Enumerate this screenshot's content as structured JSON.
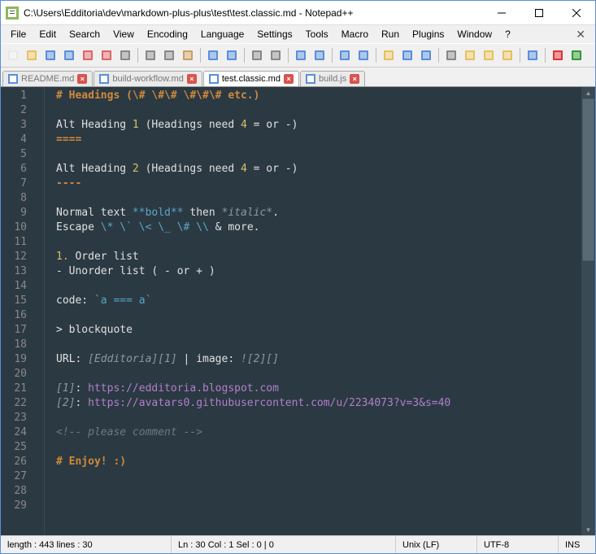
{
  "window": {
    "title": "C:\\Users\\Edditoria\\dev\\markdown-plus-plus\\test\\test.classic.md - Notepad++"
  },
  "menu": [
    "File",
    "Edit",
    "Search",
    "View",
    "Encoding",
    "Language",
    "Settings",
    "Tools",
    "Macro",
    "Run",
    "Plugins",
    "Window",
    "?"
  ],
  "tabs": [
    {
      "label": "README.md",
      "active": false
    },
    {
      "label": "build-workflow.md",
      "active": false
    },
    {
      "label": "test.classic.md",
      "active": true
    },
    {
      "label": "build.js",
      "active": false
    }
  ],
  "editor": {
    "line_count": 29,
    "lines": [
      {
        "n": 1,
        "spans": [
          {
            "t": "# Headings (\\# \\#\\# \\#\\#\\# etc.)",
            "c": "c-orange"
          }
        ]
      },
      {
        "n": 2,
        "spans": []
      },
      {
        "n": 3,
        "spans": [
          {
            "t": "Alt Heading ",
            "c": "c-white"
          },
          {
            "t": "1",
            "c": "c-yellow"
          },
          {
            "t": " (Headings need ",
            "c": "c-white"
          },
          {
            "t": "4",
            "c": "c-yellow"
          },
          {
            "t": " = or -)",
            "c": "c-white"
          }
        ]
      },
      {
        "n": 4,
        "spans": [
          {
            "t": "====",
            "c": "c-orange"
          }
        ]
      },
      {
        "n": 5,
        "spans": []
      },
      {
        "n": 6,
        "spans": [
          {
            "t": "Alt Heading ",
            "c": "c-white"
          },
          {
            "t": "2",
            "c": "c-yellow"
          },
          {
            "t": " (Headings need ",
            "c": "c-white"
          },
          {
            "t": "4",
            "c": "c-yellow"
          },
          {
            "t": " = or -)",
            "c": "c-white"
          }
        ]
      },
      {
        "n": 7,
        "spans": [
          {
            "t": "----",
            "c": "c-orange"
          }
        ]
      },
      {
        "n": 8,
        "spans": []
      },
      {
        "n": 9,
        "spans": [
          {
            "t": "Normal text ",
            "c": "c-white"
          },
          {
            "t": "**bold**",
            "c": "c-cyan"
          },
          {
            "t": " then ",
            "c": "c-white"
          },
          {
            "t": "*italic*",
            "c": "c-italic"
          },
          {
            "t": ".",
            "c": "c-white"
          }
        ]
      },
      {
        "n": 10,
        "spans": [
          {
            "t": "Escape ",
            "c": "c-white"
          },
          {
            "t": "\\* \\` \\< \\_ \\# \\\\",
            "c": "c-cyan"
          },
          {
            "t": " & more.",
            "c": "c-white"
          }
        ]
      },
      {
        "n": 11,
        "spans": []
      },
      {
        "n": 12,
        "spans": [
          {
            "t": "1.",
            "c": "c-yellow"
          },
          {
            "t": " Order list",
            "c": "c-white"
          }
        ]
      },
      {
        "n": 13,
        "spans": [
          {
            "t": "- Unorder list ( - or + )",
            "c": "c-white"
          }
        ]
      },
      {
        "n": 14,
        "spans": []
      },
      {
        "n": 15,
        "spans": [
          {
            "t": "code: ",
            "c": "c-white"
          },
          {
            "t": "`a === a`",
            "c": "c-cyan"
          }
        ]
      },
      {
        "n": 16,
        "spans": []
      },
      {
        "n": 17,
        "spans": [
          {
            "t": "> blockquote",
            "c": "c-white"
          }
        ]
      },
      {
        "n": 18,
        "spans": []
      },
      {
        "n": 19,
        "spans": [
          {
            "t": "URL: ",
            "c": "c-white"
          },
          {
            "t": "[Edditoria][1]",
            "c": "c-italic"
          },
          {
            "t": " | image: ",
            "c": "c-white"
          },
          {
            "t": "![2][]",
            "c": "c-italic"
          }
        ]
      },
      {
        "n": 20,
        "spans": []
      },
      {
        "n": 21,
        "spans": [
          {
            "t": "[1]",
            "c": "c-italic"
          },
          {
            "t": ": ",
            "c": "c-white"
          },
          {
            "t": "https://edditoria.blogspot.com",
            "c": "c-purple"
          }
        ]
      },
      {
        "n": 22,
        "spans": [
          {
            "t": "[2]",
            "c": "c-italic"
          },
          {
            "t": ": ",
            "c": "c-white"
          },
          {
            "t": "https://avatars0.githubusercontent.com/u/2234073?v=3&s=40",
            "c": "c-purple"
          }
        ]
      },
      {
        "n": 23,
        "spans": []
      },
      {
        "n": 24,
        "spans": [
          {
            "t": "<!-- please comment -->",
            "c": "c-comment"
          }
        ]
      },
      {
        "n": 25,
        "spans": []
      },
      {
        "n": 26,
        "spans": [
          {
            "t": "# Enjoy! :)",
            "c": "c-orange"
          }
        ]
      },
      {
        "n": 27,
        "spans": []
      },
      {
        "n": 28,
        "spans": []
      },
      {
        "n": 29,
        "spans": []
      }
    ]
  },
  "status": {
    "length": "length : 443    lines : 30",
    "pos": "Ln : 30    Col : 1    Sel : 0 | 0",
    "eol": "Unix (LF)",
    "enc": "UTF-8",
    "ins": "INS"
  },
  "toolbar_icons": [
    "new-file",
    "open-file",
    "save",
    "save-all",
    "close",
    "close-all",
    "print",
    "sep",
    "cut",
    "copy",
    "paste",
    "sep",
    "undo",
    "redo",
    "sep",
    "find",
    "replace",
    "sep",
    "zoom-in",
    "zoom-out",
    "sep",
    "sync-v",
    "sync-h",
    "sep",
    "wrap",
    "all-chars",
    "indent-guide",
    "sep",
    "lang",
    "doc-map",
    "func-list",
    "folder",
    "sep",
    "monitor",
    "sep",
    "record",
    "play"
  ]
}
